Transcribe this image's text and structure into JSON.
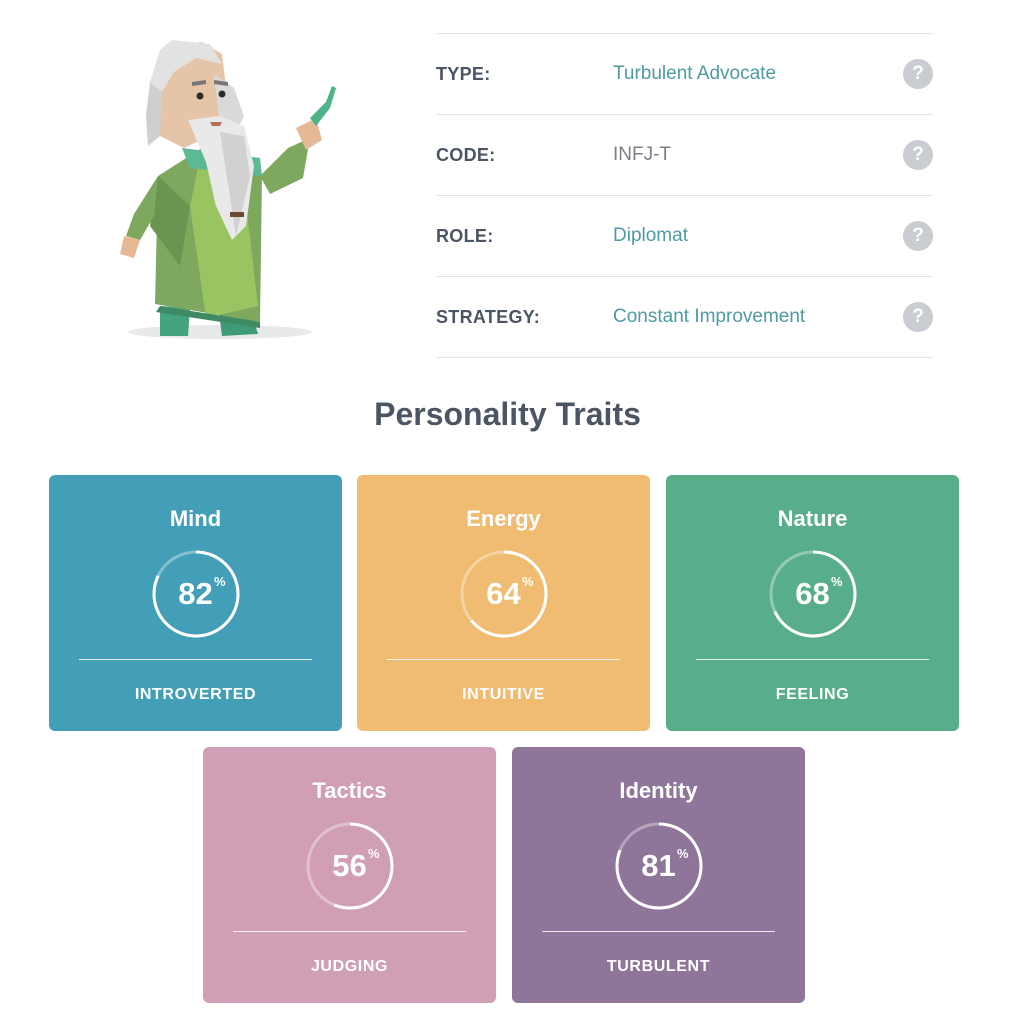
{
  "info": [
    {
      "label": "TYPE:",
      "value": "Turbulent Advocate",
      "value_color": "#4f9aa3",
      "help": "?"
    },
    {
      "label": "CODE:",
      "value": "INFJ-T",
      "value_color": "#7a7f87",
      "help": "?"
    },
    {
      "label": "ROLE:",
      "value": "Diplomat",
      "value_color": "#4f9aa3",
      "help": "?"
    },
    {
      "label": "STRATEGY:",
      "value": "Constant Improvement",
      "value_color": "#4f9aa3",
      "help": "?"
    }
  ],
  "section_title": "Personality Traits",
  "traits": [
    {
      "name": "Mind",
      "value": "82",
      "pct_symbol": "%",
      "side": "INTROVERTED",
      "fraction": 0.82,
      "color": "#439eb8"
    },
    {
      "name": "Energy",
      "value": "64",
      "pct_symbol": "%",
      "side": "INTUITIVE",
      "fraction": 0.64,
      "color": "#f0bc72"
    },
    {
      "name": "Nature",
      "value": "68",
      "pct_symbol": "%",
      "side": "FEELING",
      "fraction": 0.68,
      "color": "#58ae8a"
    },
    {
      "name": "Tactics",
      "value": "56",
      "pct_symbol": "%",
      "side": "JUDGING",
      "fraction": 0.56,
      "color": "#d19fb5"
    },
    {
      "name": "Identity",
      "value": "81",
      "pct_symbol": "%",
      "side": "TURBULENT",
      "fraction": 0.81,
      "color": "#8e7599"
    }
  ]
}
